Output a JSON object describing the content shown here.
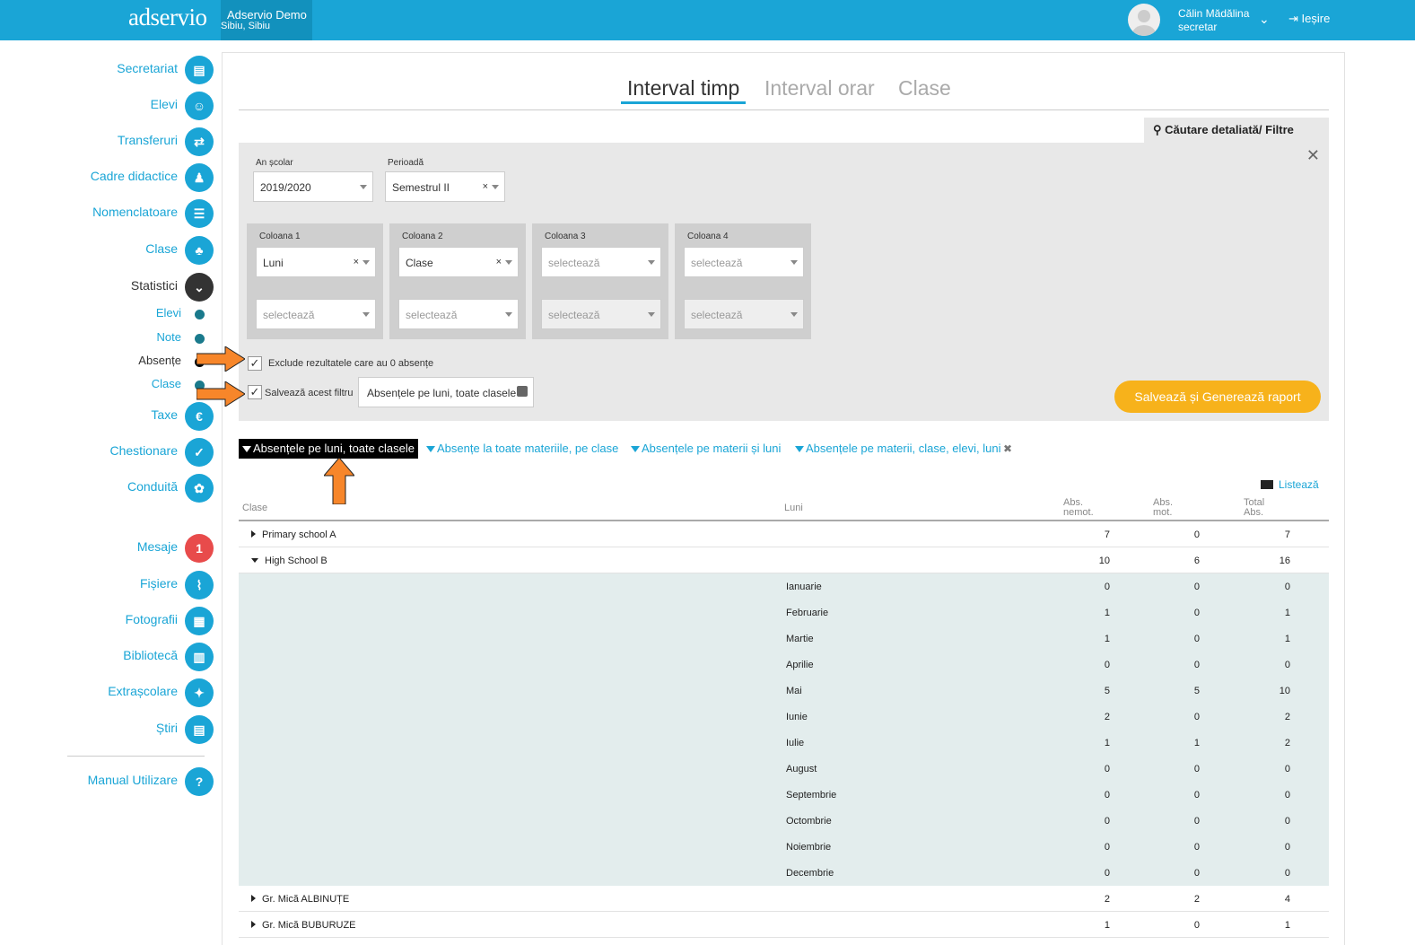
{
  "header": {
    "logo": "adservio",
    "school_name": "Adservio Demo",
    "school_location": "Sibiu, Sibiu",
    "user_name": "Călin Mădălina",
    "user_role": "secretar",
    "logout": "Ieșire",
    "brand_color": "#1aa5d6"
  },
  "sidebar": {
    "items": [
      {
        "label": "Secretariat",
        "icon": "secretariat-icon",
        "glyph": "▤"
      },
      {
        "label": "Elevi",
        "icon": "student-icon",
        "glyph": "☺"
      },
      {
        "label": "Transferuri",
        "icon": "transfer-icon",
        "glyph": "⇄"
      },
      {
        "label": "Cadre didactice",
        "icon": "teacher-icon",
        "glyph": "♟"
      },
      {
        "label": "Nomenclatoare",
        "icon": "nomenclature-icon",
        "glyph": "☰"
      },
      {
        "label": "Clase",
        "icon": "classes-icon",
        "glyph": "♣"
      },
      {
        "label": "Statistici",
        "icon": "chevron-down-icon",
        "glyph": "⌄"
      }
    ],
    "subitems": [
      "Elevi",
      "Note",
      "Absențe",
      "Clase"
    ],
    "items2": [
      {
        "label": "Taxe",
        "icon": "euro-icon",
        "glyph": "€"
      },
      {
        "label": "Chestionare",
        "icon": "survey-icon",
        "glyph": "✓"
      },
      {
        "label": "Conduită",
        "icon": "conduct-icon",
        "glyph": "✿"
      },
      {
        "label": "Mesaje",
        "icon": "messages-badge",
        "glyph": "1"
      },
      {
        "label": "Fișiere",
        "icon": "paperclip-icon",
        "glyph": "⌇"
      },
      {
        "label": "Fotografii",
        "icon": "photos-icon",
        "glyph": "▦"
      },
      {
        "label": "Bibliotecă",
        "icon": "library-icon",
        "glyph": "▥"
      },
      {
        "label": "Extrașcolare",
        "icon": "extracurricular-icon",
        "glyph": "✦"
      },
      {
        "label": "Știri",
        "icon": "news-icon",
        "glyph": "▤"
      }
    ],
    "manual": {
      "label": "Manual Utilizare",
      "glyph": "?"
    }
  },
  "tabs": [
    "Interval timp",
    "Interval orar",
    "Clase"
  ],
  "filter": {
    "tab_label": "Căutare detaliată/ Filtre",
    "an_label": "An școlar",
    "an_value": "2019/2020",
    "perioada_label": "Perioadă",
    "perioada_value": "Semestrul II",
    "columns": [
      {
        "label": "Coloana 1",
        "v1": "Luni",
        "v2": "selectează"
      },
      {
        "label": "Coloana 2",
        "v1": "Clase",
        "v2": "selectează"
      },
      {
        "label": "Coloana 3",
        "v1": "selectează",
        "v2": "selectează"
      },
      {
        "label": "Coloana 4",
        "v1": "selectează",
        "v2": "selectează"
      }
    ],
    "exclude_label": "Exclude rezultatele care au 0 absențe",
    "save_filter_label": "Salvează acest filtru",
    "filter_name": "Absențele pe luni, toate clasele",
    "save_button": "Salvează și Generează raport"
  },
  "saved_filters": [
    "Absențele pe luni, toate clasele",
    "Absențe la toate materiile, pe clase",
    "Absențele pe materii și luni",
    "Absențele pe materii, clase, elevi, luni"
  ],
  "print_label": "Listează",
  "table": {
    "headers": {
      "clase": "Clase",
      "luni": "Luni",
      "nemot_1": "Abs.",
      "nemot_2": "nemot.",
      "mot_1": "Abs.",
      "mot_2": "mot.",
      "total_1": "Total",
      "total_2": "Abs."
    },
    "groups": [
      {
        "name": "Primary school A",
        "nemot": "7",
        "mot": "0",
        "total": "7"
      },
      {
        "name": "High School B",
        "nemot": "10",
        "mot": "6",
        "total": "16"
      },
      {
        "name": "Gr. Mică ALBINUȚE",
        "nemot": "2",
        "mot": "2",
        "total": "4"
      },
      {
        "name": "Gr. Mică BUBURUZE",
        "nemot": "1",
        "mot": "0",
        "total": "1"
      }
    ],
    "months": [
      {
        "luna": "Ianuarie",
        "nemot": "0",
        "mot": "0",
        "total": "0"
      },
      {
        "luna": "Februarie",
        "nemot": "1",
        "mot": "0",
        "total": "1"
      },
      {
        "luna": "Martie",
        "nemot": "1",
        "mot": "0",
        "total": "1"
      },
      {
        "luna": "Aprilie",
        "nemot": "0",
        "mot": "0",
        "total": "0"
      },
      {
        "luna": "Mai",
        "nemot": "5",
        "mot": "5",
        "total": "10"
      },
      {
        "luna": "Iunie",
        "nemot": "2",
        "mot": "0",
        "total": "2"
      },
      {
        "luna": "Iulie",
        "nemot": "1",
        "mot": "1",
        "total": "2"
      },
      {
        "luna": "August",
        "nemot": "0",
        "mot": "0",
        "total": "0"
      },
      {
        "luna": "Septembrie",
        "nemot": "0",
        "mot": "0",
        "total": "0"
      },
      {
        "luna": "Octombrie",
        "nemot": "0",
        "mot": "0",
        "total": "0"
      },
      {
        "luna": "Noiembrie",
        "nemot": "0",
        "mot": "0",
        "total": "0"
      },
      {
        "luna": "Decembrie",
        "nemot": "0",
        "mot": "0",
        "total": "0"
      }
    ]
  },
  "annotation_color": "#f7862a"
}
